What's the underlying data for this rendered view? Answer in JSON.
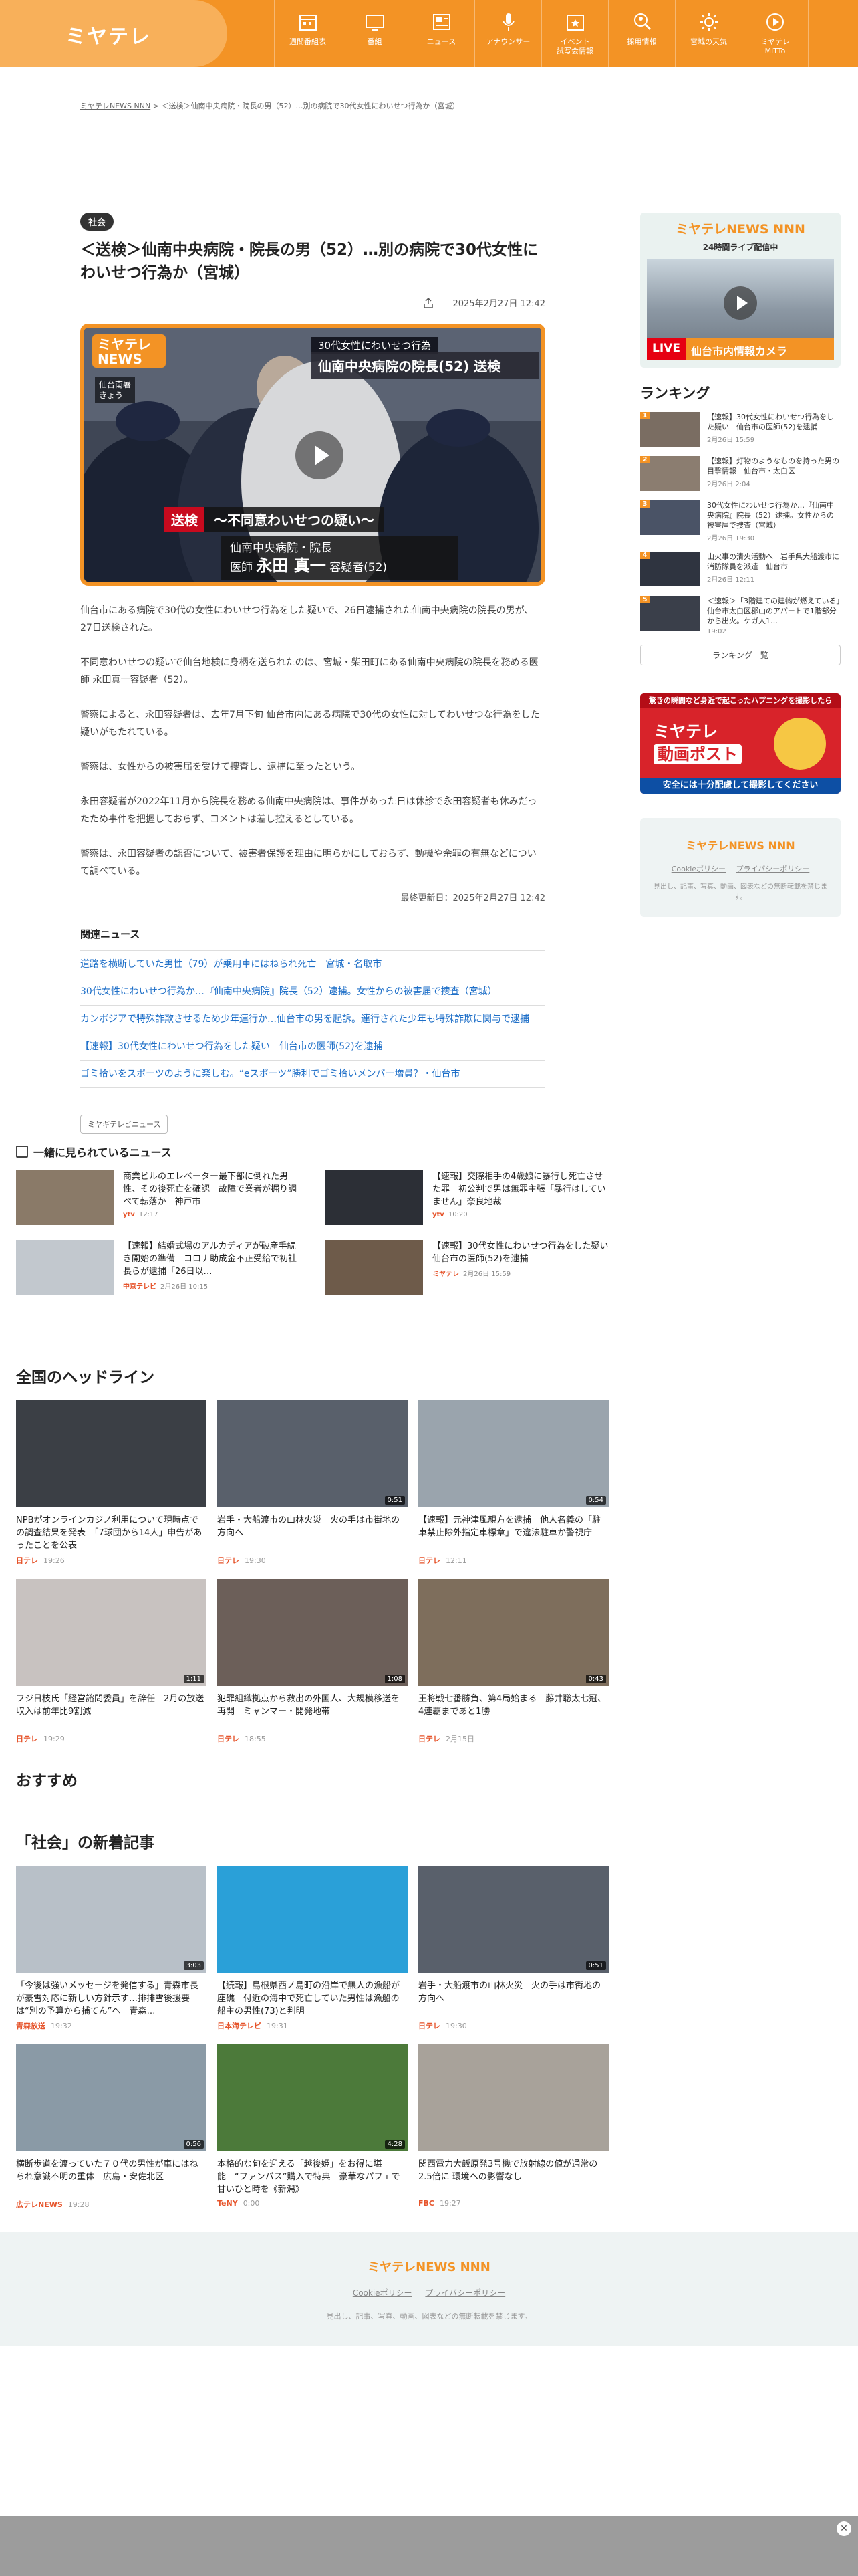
{
  "header": {
    "logo": "ミヤテレ",
    "nav": [
      {
        "label": "週間番組表",
        "icon": "calendar-icon"
      },
      {
        "label": "番組",
        "icon": "tv-icon"
      },
      {
        "label": "ニュース",
        "icon": "news-icon"
      },
      {
        "label": "アナウンサー",
        "icon": "microphone-icon"
      },
      {
        "label": "イベント\n試写会情報",
        "icon": "event-icon"
      },
      {
        "label": "採用情報",
        "icon": "search-person-icon"
      },
      {
        "label": "宮城の天気",
        "icon": "weather-icon"
      },
      {
        "label": "ミヤテレ\nMiTTo",
        "icon": "play-icon"
      }
    ]
  },
  "breadcrumb": {
    "home": "ミヤテレNEWS NNN",
    "sep": ">",
    "current": "＜送検＞仙南中央病院・院長の男（52）…別の病院で30代女性にわいせつ行為か（宮城）"
  },
  "article": {
    "tag": "社会",
    "title": "＜送検＞仙南中央病院・院長の男（52）…別の病院で30代女性にわいせつ行為か（宮城）",
    "date": "2025年2月27日 12:42",
    "video": {
      "news_badge": "ミヤテレ NEWS",
      "place": "仙台南署\nきょう",
      "caption_top": "30代女性にわいせつ行為",
      "caption_main": "仙南中央病院の院長(52) 送検",
      "red_label": "送検",
      "doubt": "〜不同意わいせつの疑い〜",
      "hospital": "仙南中央病院・院長",
      "doctor_prefix": "医師",
      "doctor_name": "永田 真一",
      "doctor_suffix": "容疑者(52)"
    },
    "paragraphs": [
      "仙台市にある病院で30代の女性にわいせつ行為をした疑いで、26日逮捕された仙南中央病院の院長の男が、27日送検された。",
      "不同意わいせつの疑いで仙台地検に身柄を送られたのは、宮城・柴田町にある仙南中央病院の院長を務める医師 永田真一容疑者（52）。",
      "警察によると、永田容疑者は、去年7月下旬 仙台市内にある病院で30代の女性に対してわいせつな行為をした疑いがもたれている。",
      "警察は、女性からの被害届を受けて捜査し、逮捕に至ったという。",
      "永田容疑者が2022年11月から院長を務める仙南中央病院は、事件があった日は休診で永田容疑者も休みだったため事件を把握しておらず、コメントは差し控えるとしている。",
      "警察は、永田容疑者の認否について、被害者保護を理由に明らかにしておらず、動機や余罪の有無などについて調べている。"
    ],
    "updated": "最終更新日：2025年2月27日 12:42",
    "related_heading": "関連ニュース",
    "related": [
      "道路を横断していた男性（79）が乗用車にはねられ死亡　宮城・名取市",
      "30代女性にわいせつ行為か…『仙南中央病院』院長（52）逮捕。女性からの被害届で捜査（宮城）",
      "カンボジアで特殊詐欺させるため少年連行か…仙台市の男を起訴。連行された少年も特殊詐欺に関与で逮捕",
      "【速報】30代女性にわいせつ行為をした疑い　仙台市の医師(52)を逮捕",
      "ゴミ拾いをスポーツのように楽しむ。“eスポーツ”勝利でゴミ拾いメンバー増員？・仙台市"
    ],
    "station_pill": "ミヤギテレビニュース"
  },
  "sidebar": {
    "live_logo": "ミヤテレNEWS NNN",
    "live_sub": "24時間ライブ配信中",
    "live_tag": "LIVE",
    "live_text": "仙台市内情報カメラ",
    "ranking_heading": "ランキング",
    "ranking": [
      {
        "n": "1",
        "text": "【速報】30代女性にわいせつ行為をした疑い　仙台市の医師(52)を逮捕",
        "date": "2月26日 15:59"
      },
      {
        "n": "2",
        "text": "【速報】灯物のようなものを持った男の目撃情報　仙台市・太白区",
        "date": "2月26日 2:04"
      },
      {
        "n": "3",
        "text": "30代女性にわいせつ行為か…『仙南中央病院』院長（52）逮捕。女性からの被害届で捜査（宮城）",
        "date": "2月26日 19:30"
      },
      {
        "n": "4",
        "text": "山火事の清火活動へ　岩手県大船渡市に消防隊員を派遣　仙台市",
        "date": "2月26日 12:11"
      },
      {
        "n": "5",
        "text": "＜速報＞「3階建ての建物が燃えている」仙台市太白区郡山のアパートで1階部分から出火。ケガ人1…",
        "date": "19:02"
      }
    ],
    "ranking_more": "ランキング一覧",
    "banner_top": "驚きの瞬間など身近で起こったハプニングを撮影したら",
    "banner_logo1": "ミヤテレ",
    "banner_logo2": "動画ポスト",
    "banner_foot": "安全には十分配慮して撮影してください",
    "foot_logo": "ミヤテレNEWS NNN",
    "cookie": "Cookieポリシー",
    "privacy": "プライバシーポリシー",
    "note": "見出し、記事、写真、動画、図表などの無断転載を禁じます。"
  },
  "together": {
    "heading": "一緒に見られているニュース",
    "items": [
      {
        "text": "商業ビルのエレベーター最下部に倒れた男性、その後死亡を確認　故障で業者が掘り調べて転落か　神戸市",
        "src": "ytv",
        "time": "12:17"
      },
      {
        "text": "【速報】交際相手の4歳娘に暴行し死亡させた罪　初公判で男は無罪主張「暴行はしていません」奈良地裁",
        "src": "ytv",
        "time": "10:20"
      },
      {
        "text": "【速報】結婚式場のアルカディアが破産手続き開始の準備　コロナ助成金不正受給で初社長らが逮捕「26日以…",
        "src": "中京テレビ",
        "time": "2月26日 10:15"
      },
      {
        "text": "【速報】30代女性にわいせつ行為をした疑い　仙台市の医師(52)を逮捕",
        "src": "ミヤテレ",
        "time": "2月26日 15:59"
      }
    ]
  },
  "national": {
    "heading": "全国のヘッドライン",
    "cards": [
      {
        "text": "NPBがオンラインカジノ利用について現時点での調査結果を発表　「7球団から14人」申告があったことを公表",
        "src": "日テレ",
        "time": "19:26",
        "dur": "",
        "bg": "#3b3f45"
      },
      {
        "text": "岩手・大船渡市の山林火災　火の手は市街地の方向へ",
        "src": "日テレ",
        "time": "19:30",
        "dur": "0:51",
        "bg": "#59606b"
      },
      {
        "text": "【速報】元神津風親方を逮捕　他人名義の「駐車禁止除外指定車標章」で違法駐車か警視庁",
        "src": "日テレ",
        "time": "12:11",
        "dur": "0:54",
        "bg": "#9aa4ad"
      },
      {
        "text": "フジ日枝氏「経営諮問委員」を辞任　2月の放送収入は前年比9割減",
        "src": "日テレ",
        "time": "19:29",
        "dur": "1:11",
        "bg": "#c8c2c0"
      },
      {
        "text": "犯罪組織拠点から救出の外国人、大規模移送を再開　ミャンマー・開発地帯",
        "src": "日テレ",
        "time": "18:55",
        "dur": "1:08",
        "bg": "#6c5f59"
      },
      {
        "text": "王将戦七番勝負、第4局始まる　藤井聡太七冠、4連覇まであと1勝",
        "src": "日テレ",
        "time": "2月15日",
        "dur": "0:43",
        "bg": "#7e6e5c"
      }
    ]
  },
  "osusume_heading": "おすすめ",
  "society": {
    "heading": "「社会」の新着記事",
    "cards": [
      {
        "text": "「今後は強いメッセージを発信する」青森市長が豪雪対応に新しい方針示す…排排雪後援要は“別の予算から捕てん”へ　青森…",
        "src": "青森放送",
        "time": "19:32",
        "dur": "3:03",
        "bg": "#b8c0c8"
      },
      {
        "text": "【続報】島根県西ノ島町の沿岸で無人の漁船が座礁　付近の海中で死亡していた男性は漁船の船主の男性(73)と判明",
        "src": "日本海テレビ",
        "time": "19:31",
        "dur": "",
        "bg": "#2aa0d8"
      },
      {
        "text": "岩手・大船渡市の山林火災　火の手は市街地の方向へ",
        "src": "日テレ",
        "time": "19:30",
        "dur": "0:51",
        "bg": "#59606b"
      },
      {
        "text": "横断歩道を渡っていた７０代の男性が車にはねられ意識不明の重体　広島・安佐北区",
        "src": "広テレNEWS",
        "time": "19:28",
        "dur": "0:56",
        "bg": "#8a9aa6"
      },
      {
        "text": "本格的な旬を迎える「越後姫」をお得に堪能　“ファンパス”購入で特典　豪華なパフェで甘いひと時を《新潟》",
        "src": "TeNY",
        "time": "0:00",
        "dur": "4:28",
        "bg": "#4c7a3a"
      },
      {
        "text": "関西電力大飯原発3号機で放射線の値が通常の2.5倍に 環境への影響なし",
        "src": "FBC",
        "time": "19:27",
        "dur": "",
        "bg": "#a8a29a"
      }
    ]
  },
  "footer": {
    "logo": "ミヤテレNEWS NNN",
    "cookie": "Cookieポリシー",
    "privacy": "プライバシーポリシー",
    "note": "見出し、記事、写真、動画、図表などの無断転載を禁じます。"
  },
  "adbar": {
    "close": "✕"
  }
}
